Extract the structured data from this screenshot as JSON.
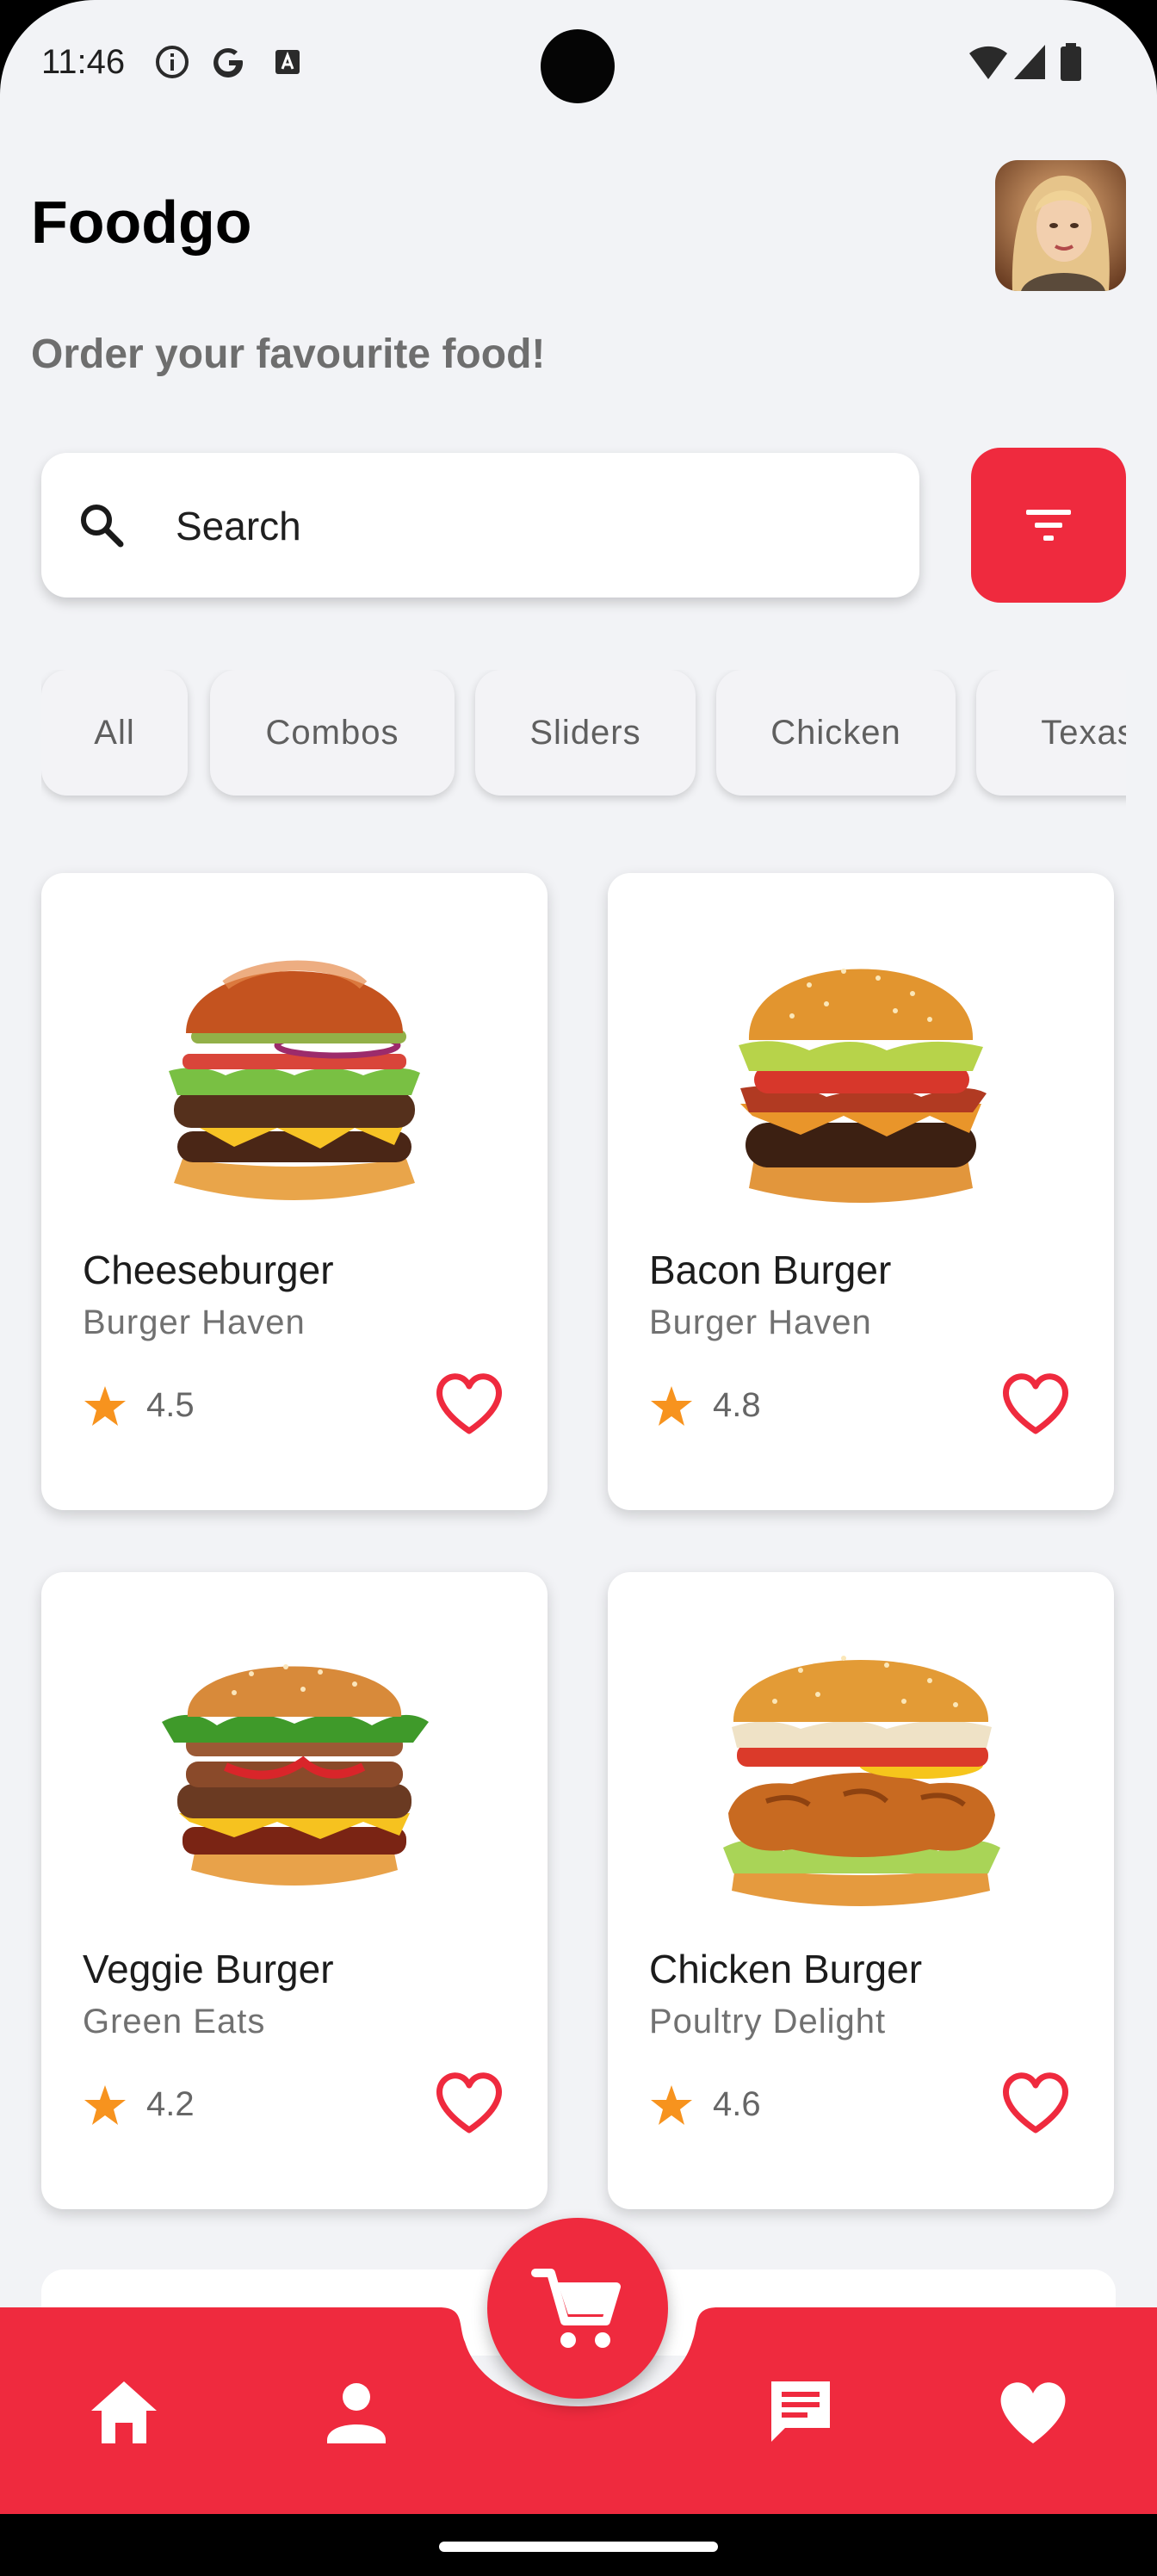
{
  "status_bar": {
    "time": "11:46"
  },
  "header": {
    "title": "Foodgo",
    "subtitle": "Order your favourite food!"
  },
  "search": {
    "placeholder": "Search"
  },
  "categories": [
    "All",
    "Combos",
    "Sliders",
    "Chicken",
    "Texas"
  ],
  "products": [
    {
      "name": "Cheeseburger",
      "restaurant": "Burger Haven",
      "rating": "4.5"
    },
    {
      "name": "Bacon Burger",
      "restaurant": "Burger Haven",
      "rating": "4.8"
    },
    {
      "name": "Veggie Burger",
      "restaurant": "Green Eats",
      "rating": "4.2"
    },
    {
      "name": "Chicken Burger",
      "restaurant": "Poultry Delight",
      "rating": "4.6"
    }
  ],
  "bottom_nav": {
    "items": [
      "home-icon",
      "profile-icon",
      "cart-icon",
      "chat-icon",
      "favorites-icon"
    ]
  },
  "colors": {
    "accent": "#ef2a3e",
    "background": "#f2f3f6",
    "star": "#f7931e"
  }
}
